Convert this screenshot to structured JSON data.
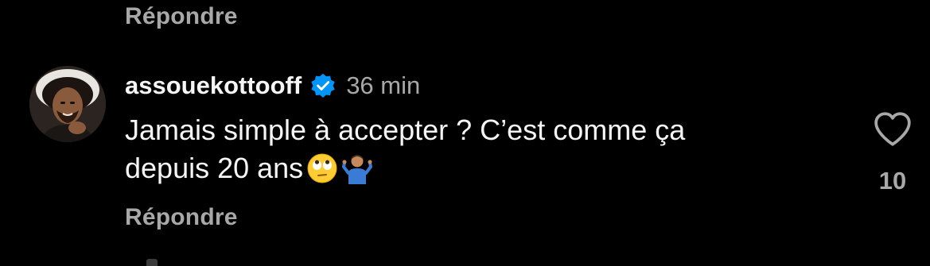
{
  "previous_comment": {
    "reply_label": "Répondre"
  },
  "comment": {
    "username": "assouekottooff",
    "verified": true,
    "time_ago": "36 min",
    "text_line1": "Jamais simple à accepter ? C’est comme ça",
    "text_line2": "depuis 20 ans",
    "emojis": [
      "face-with-rolling-eyes-emoji",
      "person-shrugging-emoji"
    ],
    "like_icon": "heart-outline-icon",
    "like_count": "10",
    "reply_label": "Répondre"
  },
  "colors": {
    "background": "#000000",
    "primary_text": "#f5f5f5",
    "secondary_text": "#a8a8a8",
    "verified_badge": "#0095f6"
  }
}
